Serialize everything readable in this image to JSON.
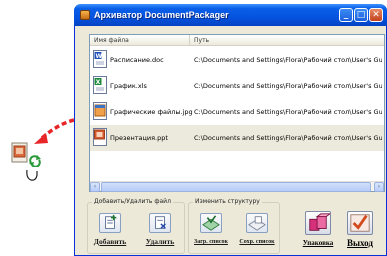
{
  "window": {
    "title": "Архиватор DocumentPackager",
    "controls": {
      "minimize": "_",
      "maximize": "□",
      "close": "✕"
    }
  },
  "list": {
    "columns": [
      "Имя файла",
      "Путь"
    ],
    "rows": [
      {
        "name": "Расписание.doc",
        "path": "C:\\Documents and Settings\\Flora\\Рабочий стол\\User's Guide",
        "icon": "word-doc-icon",
        "selected": false
      },
      {
        "name": "График.xls",
        "path": "C:\\Documents and Settings\\Flora\\Рабочий стол\\User's Guide",
        "icon": "excel-xls-icon",
        "selected": false
      },
      {
        "name": "Графические файлы.jpg",
        "path": "C:\\Documents and Settings\\Flora\\Рабочий стол\\User's Guide",
        "icon": "image-jpg-icon",
        "selected": false
      },
      {
        "name": "Презентация.ppt",
        "path": "C:\\Documents and Settings\\Flora\\Рабочий стол\\User's Guide",
        "icon": "powerpoint-ppt-icon",
        "selected": true
      }
    ]
  },
  "groups": {
    "files": {
      "title": "Добавить/Удалить файл",
      "add_label": "Добавить",
      "remove_label": "Удалить"
    },
    "structure": {
      "title": "Изменить структуру",
      "load_label": "Загр. список",
      "save_label": "Сохр. список"
    }
  },
  "actions": {
    "pack_label": "Упаковка",
    "exit_label": "Выход"
  },
  "colors": {
    "titlebar": "#0553e0",
    "window_bg": "#ece9d8",
    "drag_arrow": "#e8262a"
  }
}
